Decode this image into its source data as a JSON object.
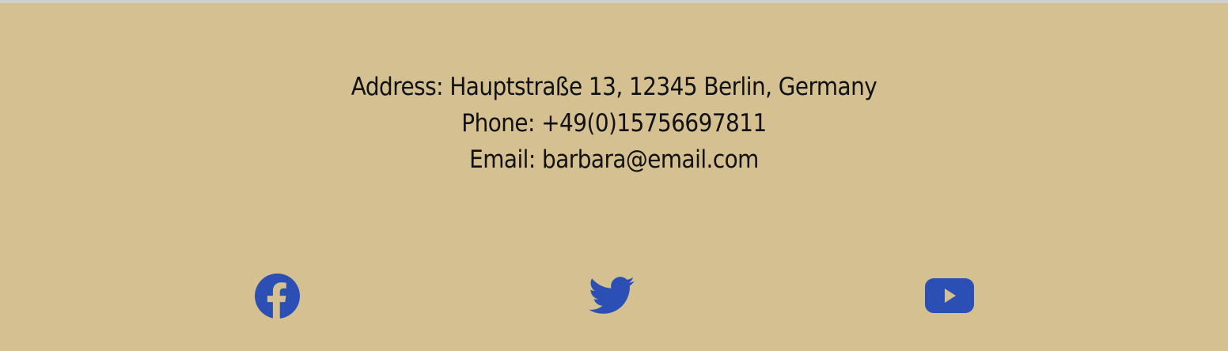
{
  "footer": {
    "contact": {
      "address": "Address: Hauptstraße 13, 12345 Berlin, Germany",
      "phone": "Phone: +49(0)15756697811",
      "email": "Email: barbara@email.com"
    },
    "social": [
      {
        "icon": "facebook-icon"
      },
      {
        "icon": "twitter-icon"
      },
      {
        "icon": "youtube-icon"
      }
    ],
    "colors": {
      "background": "#d4c090",
      "icon": "#2b4fb4",
      "text": "#111111",
      "top_border": "#cfcfcf"
    }
  }
}
